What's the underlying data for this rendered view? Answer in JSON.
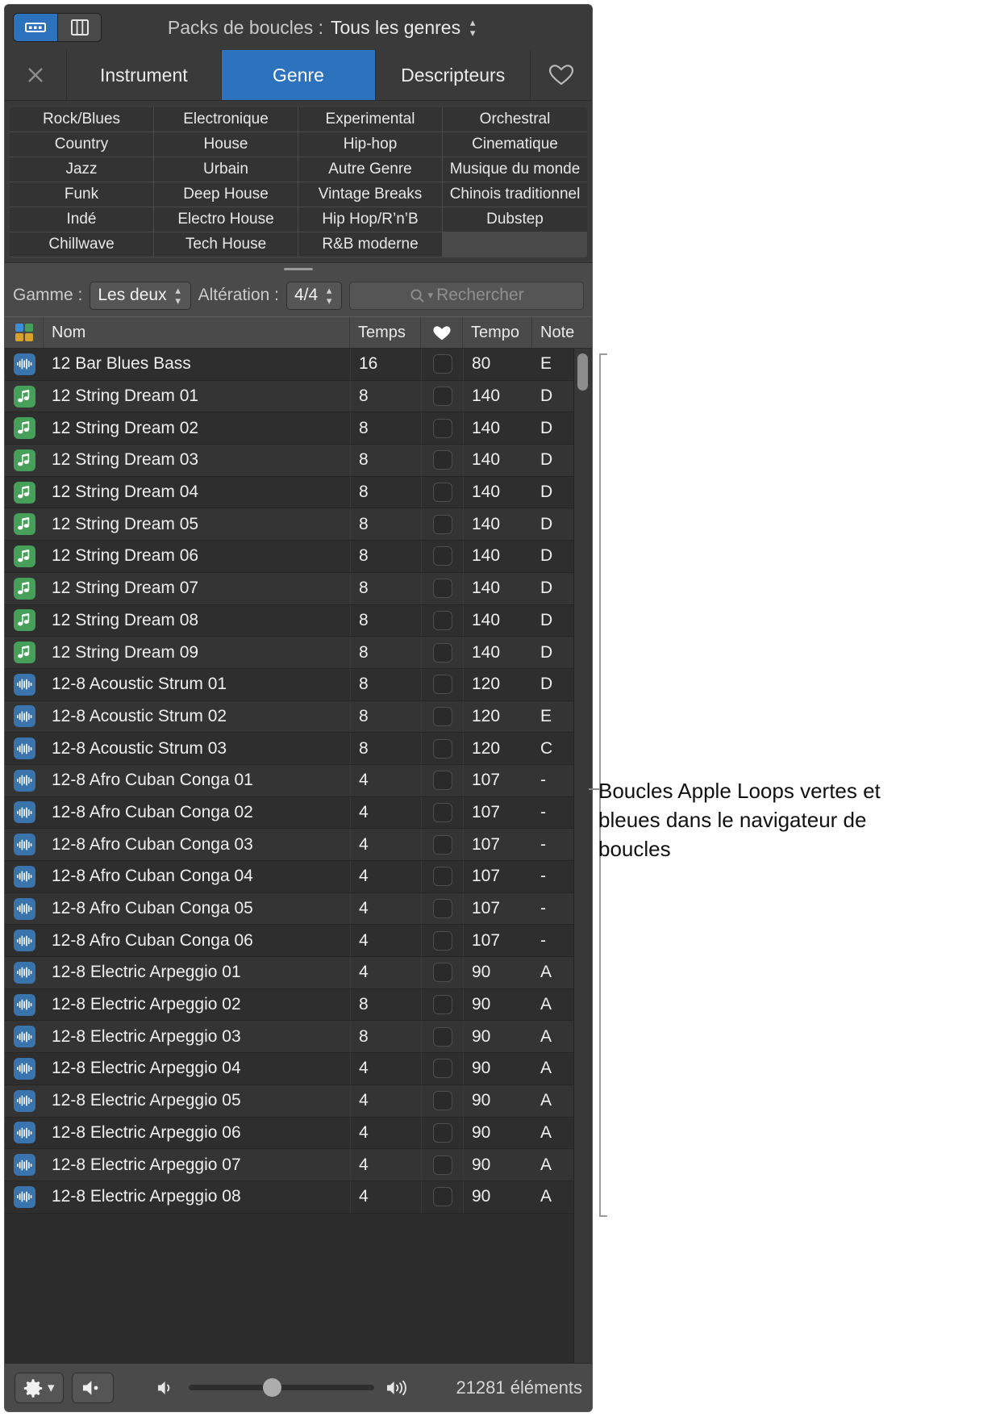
{
  "toolbar": {
    "view_buttons": [
      {
        "name": "list-view",
        "icon": "list-view-icon",
        "active": true
      },
      {
        "name": "column-view",
        "icon": "column-view-icon",
        "active": false
      }
    ],
    "packs_label": "Packs de boucles :",
    "packs_value": "Tous les genres"
  },
  "tabs": {
    "close_icon": "close-icon",
    "items": [
      {
        "label": "Instrument",
        "active": false
      },
      {
        "label": "Genre",
        "active": true
      },
      {
        "label": "Descripteurs",
        "active": false
      }
    ],
    "favorite_icon": "heart-outline-icon"
  },
  "genres": [
    "Rock/Blues",
    "Electronique",
    "Experimental",
    "Orchestral",
    "Country",
    "House",
    "Hip-hop",
    "Cinematique",
    "Jazz",
    "Urbain",
    "Autre Genre",
    "Musique du monde",
    "Funk",
    "Deep House",
    "Vintage Breaks",
    "Chinois traditionnel",
    "Indé",
    "Electro House",
    "Hip Hop/R’n’B",
    "Dubstep",
    "Chillwave",
    "Tech House",
    "R&B moderne",
    ""
  ],
  "filters": {
    "gamme_label": "Gamme :",
    "gamme_value": "Les deux",
    "alteration_label": "Altération :",
    "alteration_value": "4/4",
    "search_placeholder": "Rechercher",
    "search_value": "",
    "search_icon": "search-icon"
  },
  "table": {
    "columns": {
      "icon": "loop-type-icon",
      "name": "Nom",
      "beats": "Temps",
      "favorite": "heart-filled-icon",
      "tempo": "Tempo",
      "key": "Note"
    },
    "rows": [
      {
        "type": "audio",
        "name": "12 Bar Blues Bass",
        "beats": "16",
        "fav": false,
        "tempo": "80",
        "key": "E"
      },
      {
        "type": "midi",
        "name": "12 String Dream 01",
        "beats": "8",
        "fav": false,
        "tempo": "140",
        "key": "D"
      },
      {
        "type": "midi",
        "name": "12 String Dream 02",
        "beats": "8",
        "fav": false,
        "tempo": "140",
        "key": "D"
      },
      {
        "type": "midi",
        "name": "12 String Dream 03",
        "beats": "8",
        "fav": false,
        "tempo": "140",
        "key": "D"
      },
      {
        "type": "midi",
        "name": "12 String Dream 04",
        "beats": "8",
        "fav": false,
        "tempo": "140",
        "key": "D"
      },
      {
        "type": "midi",
        "name": "12 String Dream 05",
        "beats": "8",
        "fav": false,
        "tempo": "140",
        "key": "D"
      },
      {
        "type": "midi",
        "name": "12 String Dream 06",
        "beats": "8",
        "fav": false,
        "tempo": "140",
        "key": "D"
      },
      {
        "type": "midi",
        "name": "12 String Dream 07",
        "beats": "8",
        "fav": false,
        "tempo": "140",
        "key": "D"
      },
      {
        "type": "midi",
        "name": "12 String Dream 08",
        "beats": "8",
        "fav": false,
        "tempo": "140",
        "key": "D"
      },
      {
        "type": "midi",
        "name": "12 String Dream 09",
        "beats": "8",
        "fav": false,
        "tempo": "140",
        "key": "D"
      },
      {
        "type": "audio",
        "name": "12-8 Acoustic Strum 01",
        "beats": "8",
        "fav": false,
        "tempo": "120",
        "key": "D"
      },
      {
        "type": "audio",
        "name": "12-8 Acoustic Strum 02",
        "beats": "8",
        "fav": false,
        "tempo": "120",
        "key": "E"
      },
      {
        "type": "audio",
        "name": "12-8 Acoustic Strum 03",
        "beats": "8",
        "fav": false,
        "tempo": "120",
        "key": "C"
      },
      {
        "type": "audio",
        "name": "12-8 Afro Cuban Conga 01",
        "beats": "4",
        "fav": false,
        "tempo": "107",
        "key": "-"
      },
      {
        "type": "audio",
        "name": "12-8 Afro Cuban Conga 02",
        "beats": "4",
        "fav": false,
        "tempo": "107",
        "key": "-"
      },
      {
        "type": "audio",
        "name": "12-8 Afro Cuban Conga 03",
        "beats": "4",
        "fav": false,
        "tempo": "107",
        "key": "-"
      },
      {
        "type": "audio",
        "name": "12-8 Afro Cuban Conga 04",
        "beats": "4",
        "fav": false,
        "tempo": "107",
        "key": "-"
      },
      {
        "type": "audio",
        "name": "12-8 Afro Cuban Conga 05",
        "beats": "4",
        "fav": false,
        "tempo": "107",
        "key": "-"
      },
      {
        "type": "audio",
        "name": "12-8 Afro Cuban Conga 06",
        "beats": "4",
        "fav": false,
        "tempo": "107",
        "key": "-"
      },
      {
        "type": "audio",
        "name": "12-8 Electric Arpeggio 01",
        "beats": "4",
        "fav": false,
        "tempo": "90",
        "key": "A"
      },
      {
        "type": "audio",
        "name": "12-8 Electric Arpeggio 02",
        "beats": "8",
        "fav": false,
        "tempo": "90",
        "key": "A"
      },
      {
        "type": "audio",
        "name": "12-8 Electric Arpeggio 03",
        "beats": "8",
        "fav": false,
        "tempo": "90",
        "key": "A"
      },
      {
        "type": "audio",
        "name": "12-8 Electric Arpeggio 04",
        "beats": "4",
        "fav": false,
        "tempo": "90",
        "key": "A"
      },
      {
        "type": "audio",
        "name": "12-8 Electric Arpeggio 05",
        "beats": "4",
        "fav": false,
        "tempo": "90",
        "key": "A"
      },
      {
        "type": "audio",
        "name": "12-8 Electric Arpeggio 06",
        "beats": "4",
        "fav": false,
        "tempo": "90",
        "key": "A"
      },
      {
        "type": "audio",
        "name": "12-8 Electric Arpeggio 07",
        "beats": "4",
        "fav": false,
        "tempo": "90",
        "key": "A"
      },
      {
        "type": "audio",
        "name": "12-8 Electric Arpeggio 08",
        "beats": "4",
        "fav": false,
        "tempo": "90",
        "key": "A"
      }
    ]
  },
  "statusbar": {
    "settings_icon": "gear-icon",
    "settings_chevron": "chevron-down-icon",
    "mute_icon": "speaker-mute-icon",
    "volume_min_icon": "speaker-low-icon",
    "volume_max_icon": "speaker-high-icon",
    "item_count": "21281 éléments"
  },
  "annotation": {
    "text": "Boucles Apple Loops vertes et bleues dans le navigateur de boucles"
  },
  "colors": {
    "accent": "#2c72bd",
    "audio_loop": "#3a74ad",
    "midi_loop": "#46a05a",
    "window_bg": "#3a3a3a",
    "list_bg": "#2c2c2c"
  }
}
